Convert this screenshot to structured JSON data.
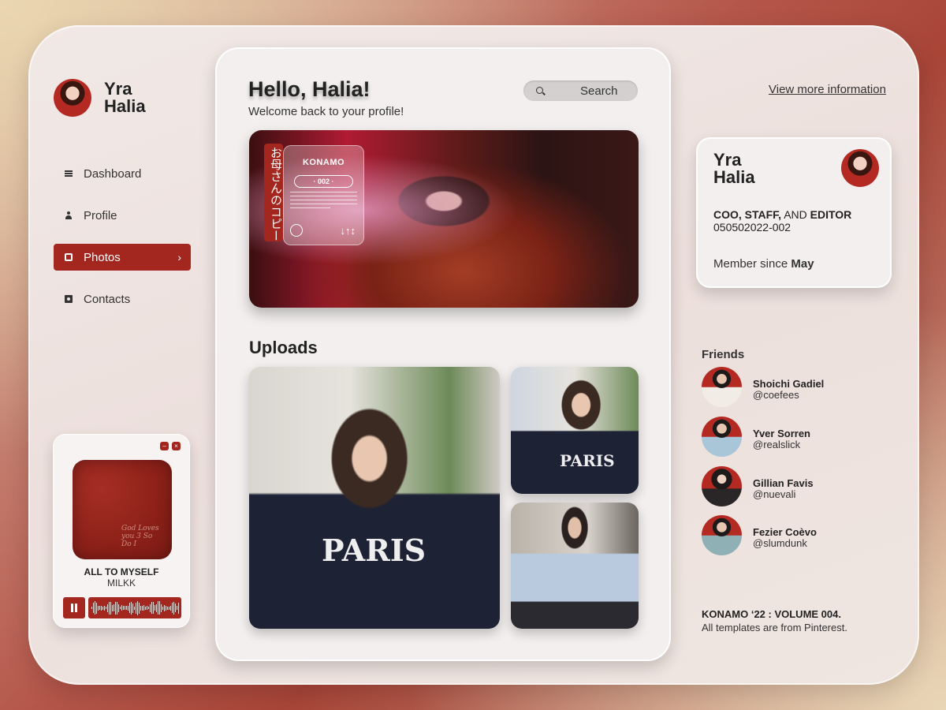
{
  "sidebar": {
    "user_name": "Yra Halia",
    "nav": [
      {
        "label": "Dashboard",
        "icon": "menu-icon"
      },
      {
        "label": "Profile",
        "icon": "person-icon"
      },
      {
        "label": "Photos",
        "icon": "photo-icon",
        "active": true
      },
      {
        "label": "Contacts",
        "icon": "contact-card-icon"
      }
    ],
    "active_chevron": "›"
  },
  "player": {
    "minimize": "–",
    "close": "×",
    "cover_text": "God Loves you 3 So Do I",
    "track": "ALL TO MYSELF",
    "artist": "MILKK"
  },
  "main": {
    "greeting": "Hello, Halia!",
    "welcome": "Welcome back to your profile!",
    "search_placeholder": "Search",
    "hero": {
      "vertical_tag": "お母さんのコピー",
      "brand": "KONAMO",
      "issue": "· 002 ·",
      "arrows": "↓↑↕"
    },
    "uploads_title": "Uploads",
    "shirt_text": "PARIS"
  },
  "right": {
    "more_link": "View more information",
    "card": {
      "name": "Yra Halia",
      "role_a": "COO, STAFF,",
      "role_and": " AND ",
      "role_b": "EDITOR",
      "id": "050502022-002",
      "member_prefix": "Member since ",
      "member_month": "May"
    },
    "friends_title": "Friends",
    "friends": [
      {
        "name": "Shoichi Gadiel",
        "handle": "@coefees"
      },
      {
        "name": "Yver Sorren",
        "handle": "@realslick"
      },
      {
        "name": "Gillian Favis",
        "handle": "@nuevali"
      },
      {
        "name": "Fezier Coèvo",
        "handle": "@slumdunk"
      }
    ],
    "footer_title": "KONAMO ‘22 : VOLUME 004.",
    "footer_sub": "All templates are from Pinterest."
  },
  "colors": {
    "accent": "#a3261f",
    "panel": "#f2efee",
    "text": "#2a2a2a"
  }
}
